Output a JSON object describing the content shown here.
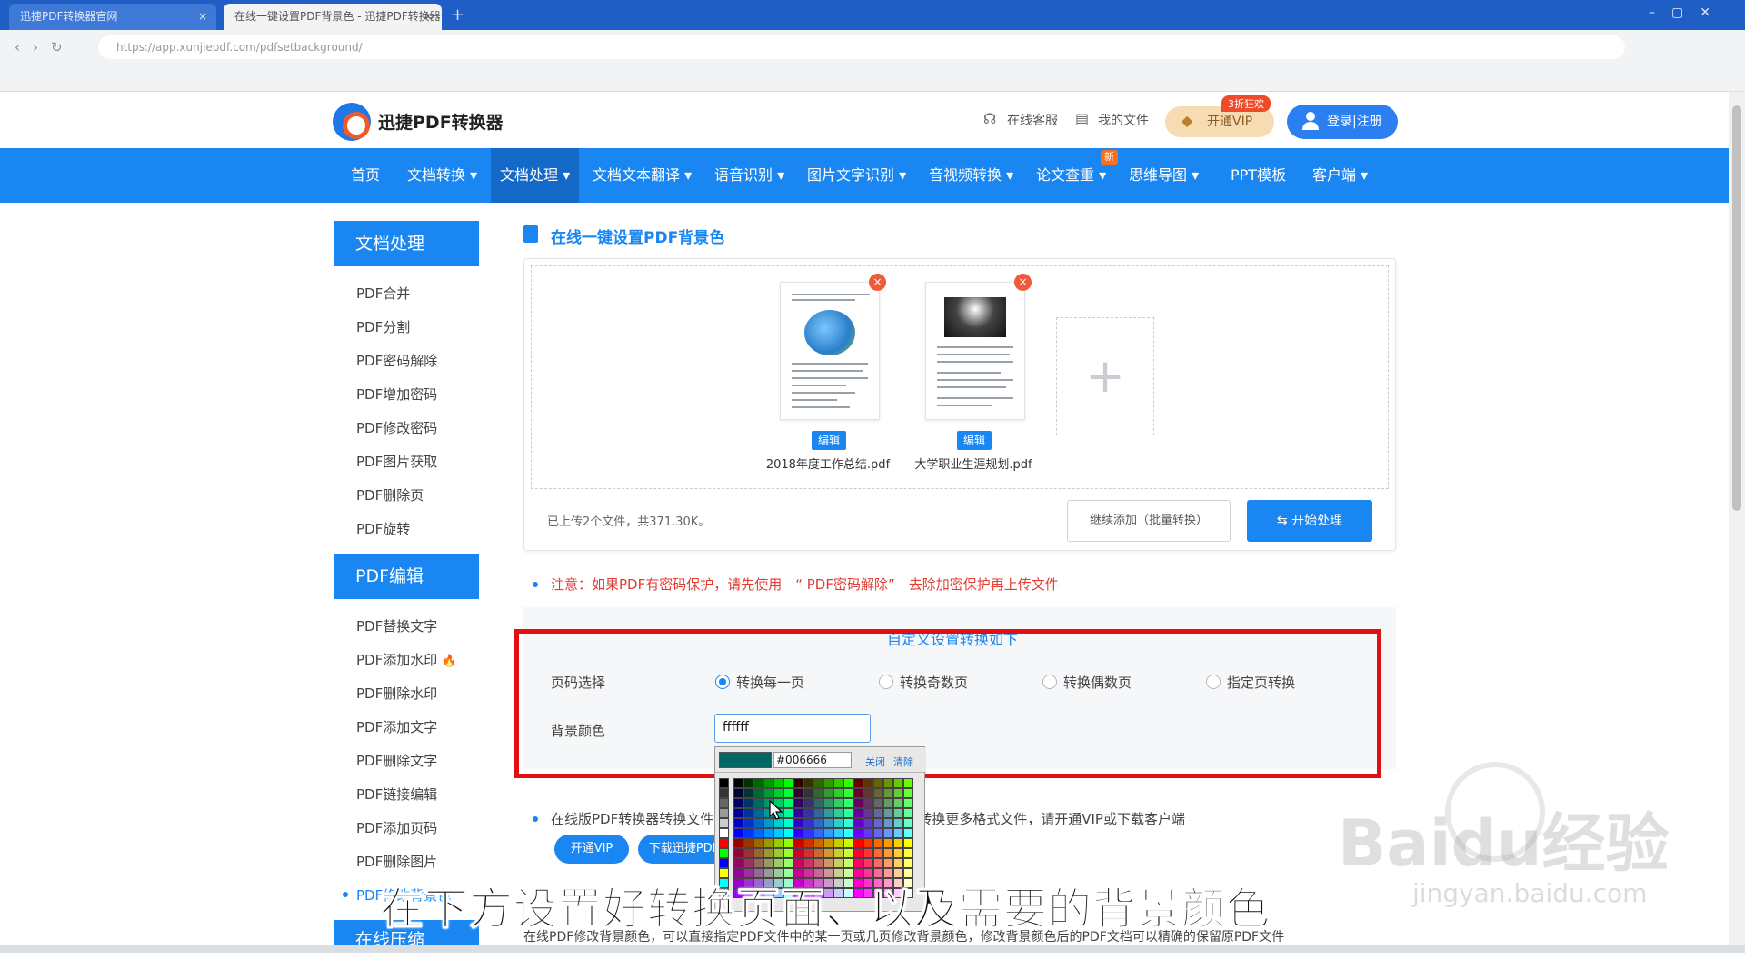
{
  "browser": {
    "tab_inactive": "迅捷PDF转换器官网",
    "tab_active": "在线一键设置PDF背景色 - 迅捷PDF转换器",
    "tab_close": "×",
    "new_tab": "+",
    "url": "https://app.xunjiepdf.com/pdfsetbackground/"
  },
  "header": {
    "logo": "迅捷PDF转换器",
    "service": "在线客服",
    "my_files": "我的文件",
    "vip_label": "开通VIP",
    "vip_badge": "3折狂欢",
    "login": "登录|注册"
  },
  "nav": {
    "items": [
      {
        "label": "首页"
      },
      {
        "label": "文档转换 ▾"
      },
      {
        "label": "文档处理 ▾"
      },
      {
        "label": "文档文本翻译 ▾"
      },
      {
        "label": "语音识别 ▾"
      },
      {
        "label": "图片文字识别 ▾"
      },
      {
        "label": "音视频转换 ▾"
      },
      {
        "label": "论文查重 ▾"
      },
      {
        "label": "思维导图 ▾"
      },
      {
        "label": "PPT模板"
      },
      {
        "label": "客户端 ▾"
      }
    ],
    "new_badge": "新"
  },
  "sidebar": {
    "section1": "文档处理",
    "items1": [
      "PDF合并",
      "PDF分割",
      "PDF密码解除",
      "PDF增加密码",
      "PDF修改密码",
      "PDF图片获取",
      "PDF删除页",
      "PDF旋转"
    ],
    "section2": "PDF编辑",
    "items2": [
      "PDF替换文字",
      "PDF添加水印",
      "PDF删除水印",
      "PDF添加文字",
      "PDF删除文字",
      "PDF链接编辑",
      "PDF添加页码",
      "PDF删除图片",
      "PDF修改背景色"
    ],
    "section3": "在线压缩",
    "hot_icon": "🔥"
  },
  "main": {
    "title": "在线一键设置PDF背景色",
    "files": [
      {
        "name": "2018年度工作总结.pdf",
        "edit": "编辑",
        "delete": "×"
      },
      {
        "name": "大学职业生涯规划.pdf",
        "edit": "编辑",
        "delete": "×"
      }
    ],
    "add_icon": "+",
    "upload_status": "已上传2个文件，共371.30K。",
    "continue_btn": "继续添加（批量转换）",
    "start_btn": "⇆ 开始处理",
    "notice": "注意：如果PDF有密码保护，请先使用　“ PDF密码解除”　去除加密保护再上传文件",
    "settings_head": "自定义设置转换如下",
    "page_label": "页码选择",
    "radios": [
      "转换每一页",
      "转换奇数页",
      "转换偶数页",
      "指定页转换"
    ],
    "selected_radio": "转换每一页",
    "bg_label": "背景颜色",
    "color_value": "ffffff"
  },
  "picker": {
    "hex": "#006666",
    "close": "关闭",
    "clear": "清除",
    "selected_color": "#006666"
  },
  "lower": {
    "bullet": "在线版PDF转换器转换文件有大小限制，如需转换更大文件、转换更多格式文件，请开通VIP或下载客户端",
    "vip_btn": "开通VIP",
    "download_btn": "下载迅捷PDF转换器",
    "bottom_text": "在线PDF修改背景颜色，可以直接指定PDF文件中的某一页或几页修改背景颜色，修改背景颜色后的PDF文档可以精确的保留原PDF文件"
  },
  "overlay": {
    "subtitle": "在下方设置好转换页面、以及需要的背景颜色",
    "watermark": "Baidu经验",
    "watermark_sub": "jingyan.baidu.com"
  }
}
